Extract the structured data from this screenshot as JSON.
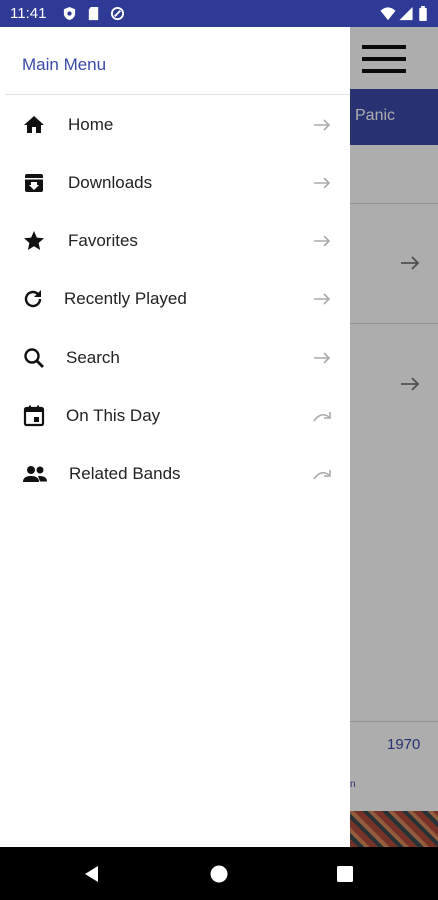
{
  "status_bar": {
    "time": "11:41",
    "left_icons": [
      "shield-icon",
      "sd-card-icon",
      "data-saver-icon"
    ],
    "right_icons": [
      "wifi-icon",
      "signal-icon",
      "battery-icon"
    ]
  },
  "background_screen": {
    "banner_text": "Panic",
    "year_text": "1970"
  },
  "drawer": {
    "title": "Main Menu",
    "items": [
      {
        "label": "Home",
        "icon": "home-icon",
        "trailing": "arrow-right-icon"
      },
      {
        "label": "Downloads",
        "icon": "download-box-icon",
        "trailing": "arrow-right-icon"
      },
      {
        "label": "Favorites",
        "icon": "star-icon",
        "trailing": "arrow-right-icon"
      },
      {
        "label": "Recently Played",
        "icon": "refresh-icon",
        "trailing": "arrow-right-icon"
      },
      {
        "label": "Search",
        "icon": "search-icon",
        "trailing": "arrow-right-icon"
      },
      {
        "label": "On This Day",
        "icon": "calendar-icon",
        "trailing": "redo-icon"
      },
      {
        "label": "Related Bands",
        "icon": "people-icon",
        "trailing": "redo-icon"
      }
    ]
  },
  "nav_bar": {
    "buttons": [
      "back-icon",
      "home-circle-icon",
      "recents-icon"
    ]
  },
  "colors": {
    "status_bar": "#2e3a95",
    "accent": "#3b4aa8",
    "scrim": "rgba(0,0,0,0.32)"
  }
}
